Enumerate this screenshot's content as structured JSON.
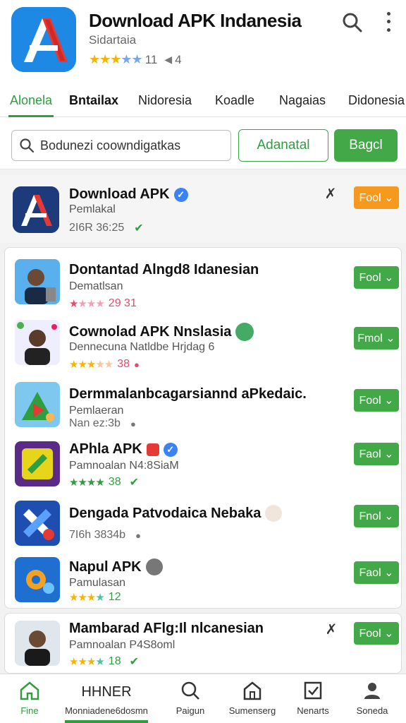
{
  "header": {
    "title": "Download APK Indanesia",
    "subtitle": "Sidartaia",
    "rating_count": "11",
    "rating_extra": "4"
  },
  "tabs": [
    {
      "label": "Alonela"
    },
    {
      "label": "Bntailax"
    },
    {
      "label": "Nidoresia"
    },
    {
      "label": "Koadle"
    },
    {
      "label": "Nagaias"
    },
    {
      "label": "Didonesia"
    }
  ],
  "search": {
    "placeholder": "Bodunezi coowndigatkas",
    "outline_button": "Adanatal",
    "solid_button": "Bagcl"
  },
  "featured": {
    "title": "Download APK",
    "subtitle": "Pemlakal",
    "meta": "2I6R 36:25",
    "button": "Fool"
  },
  "list": [
    {
      "title": "Dontantad Alngd8 Idanesian",
      "subtitle": "Dematlsan",
      "meta": "29  31",
      "button": "Fool"
    },
    {
      "title": "Cownolad APK Nnslasia",
      "subtitle": "Dennecuna Natldbe Hrjdag 6",
      "meta": "38",
      "button": "Fmol"
    },
    {
      "title": "Dermmalanbcagarsiannd aPkedaic.",
      "subtitle": "Pemlaeran",
      "meta": "Nan ez:3b",
      "button": "Fool"
    },
    {
      "title": "APhla APK",
      "subtitle": "Pamnoalan N4:8SiaM",
      "meta": "38",
      "button": "Faol"
    },
    {
      "title": "Dengada Patvodaica Nebaka",
      "subtitle": "",
      "meta": "7I6h 3834b",
      "button": "Fnol"
    },
    {
      "title": "Napul APK",
      "subtitle": "Pamulasan",
      "meta": "12",
      "button": "Faol"
    }
  ],
  "last_item": {
    "title": "Mambarad AFlg:Il nlcanesian",
    "subtitle": "Pamnoalan P4S8oml",
    "meta": "18",
    "button": "Fool"
  },
  "bottom_nav": [
    {
      "label": "Fine",
      "title": ""
    },
    {
      "label": "Monniadene6dosmn",
      "title": "HHNER"
    },
    {
      "label": "Paigun",
      "title": ""
    },
    {
      "label": "Sumenserg",
      "title": ""
    },
    {
      "label": "Nenarts",
      "title": ""
    },
    {
      "label": "Soneda",
      "title": ""
    }
  ],
  "colors": {
    "accent": "#2e9e3e",
    "button": "#43a847",
    "orange": "#f59a1f",
    "star": "#f4b400"
  }
}
